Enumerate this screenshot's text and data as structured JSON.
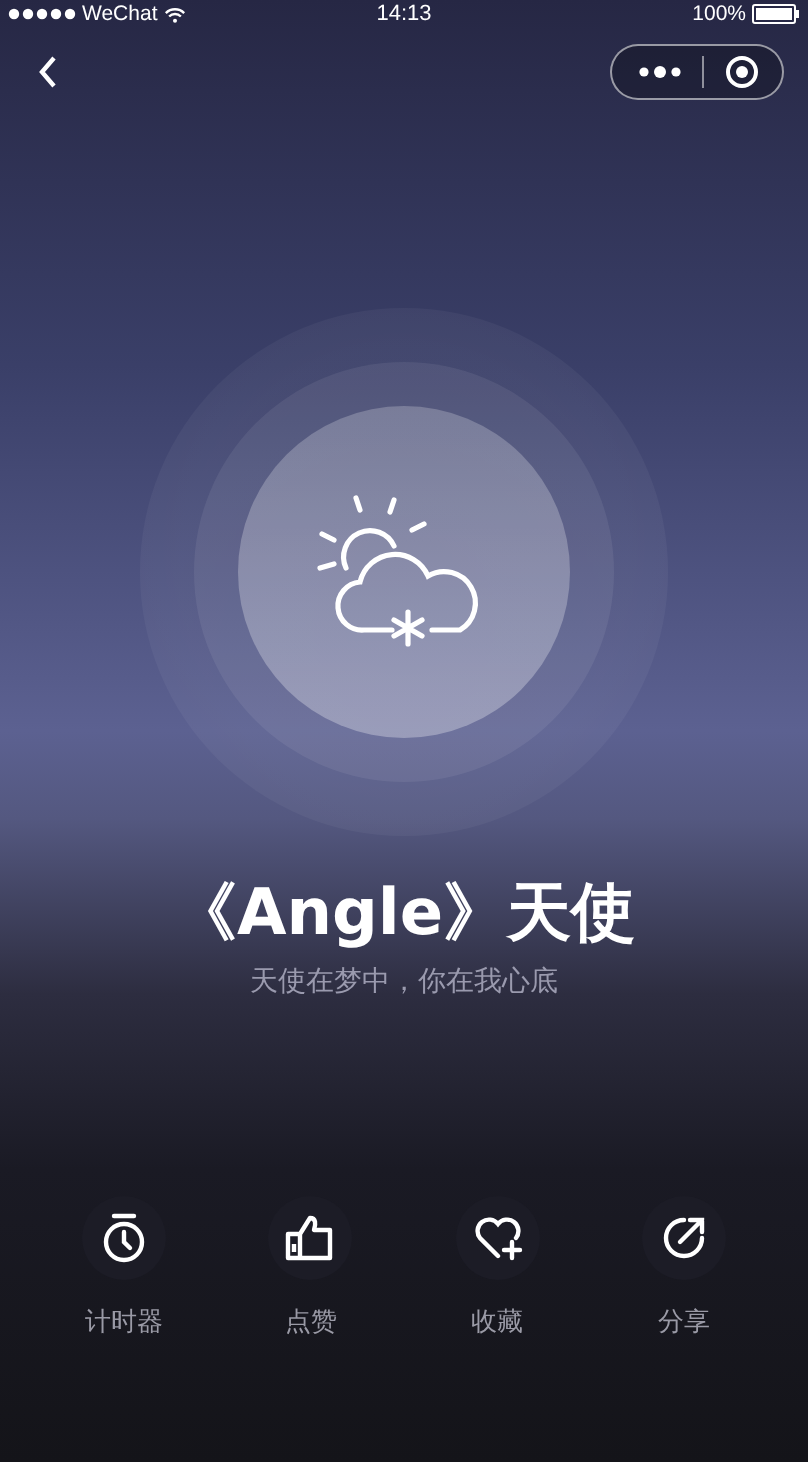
{
  "status_bar": {
    "carrier": "WeChat",
    "time": "14:13",
    "battery": "100%"
  },
  "song": {
    "title": "《Angle》天使",
    "subtitle": "天使在梦中，你在我心底"
  },
  "actions": [
    {
      "kind": "timer",
      "label": "计时器"
    },
    {
      "kind": "like",
      "label": "点赞"
    },
    {
      "kind": "favorite",
      "label": "收藏"
    },
    {
      "kind": "share",
      "label": "分享"
    }
  ]
}
